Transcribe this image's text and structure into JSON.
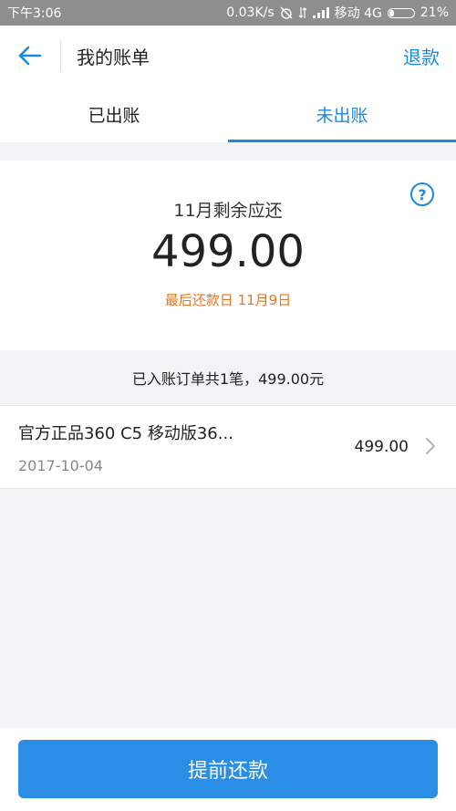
{
  "statusbar": {
    "time": "下午3:06",
    "network_speed": "0.03K/s",
    "carrier": "移动 4G",
    "battery": "21%",
    "battery_level": 0.21
  },
  "navbar": {
    "back_icon": "back-arrow-icon",
    "title": "我的账单",
    "refund_label": "退款"
  },
  "tabs": [
    {
      "label": "已出账",
      "active": false
    },
    {
      "label": "未出账",
      "active": true
    }
  ],
  "summary": {
    "label": "11月剩余应还",
    "amount": "499.00",
    "due_date_text": "最后还款日 11月9日",
    "help_icon": "help-icon"
  },
  "orders_info": "已入账订单共1笔，499.00元",
  "orders": [
    {
      "name": "官方正品360 C5 移动版36...",
      "date": "2017-10-04",
      "amount": "499.00"
    }
  ],
  "bottom": {
    "prepay_label": "提前还款"
  },
  "colors": {
    "accent": "#1a8ae0",
    "due_date": "#e8751f",
    "button": "#2a8ee6"
  }
}
